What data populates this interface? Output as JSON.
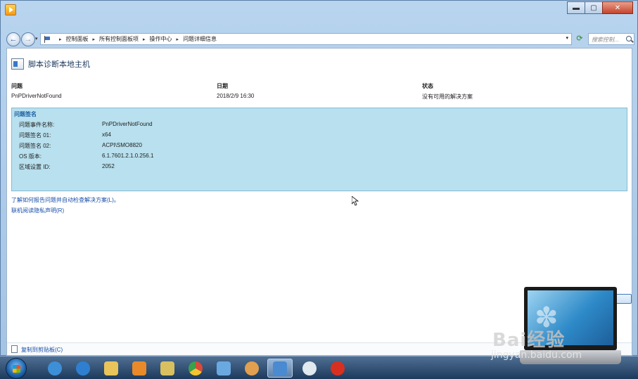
{
  "window": {
    "caption_buttons": {
      "minimize": "▬",
      "maximize": "▢",
      "close": "✕"
    }
  },
  "breadcrumb": [
    "控制面板",
    "所有控制面板项",
    "操作中心",
    "问题详细信息"
  ],
  "search": {
    "placeholder": "搜索控制..."
  },
  "page": {
    "title": "脚本诊断本地主机"
  },
  "problem": {
    "headers": {
      "problem": "问题",
      "date": "日期",
      "status": "状态"
    },
    "values": {
      "problem": "PnPDriverNotFound",
      "date": "2018/2/9 16:30",
      "status": "没有可用的解决方案"
    }
  },
  "signature": {
    "title": "问题签名",
    "rows": [
      {
        "label": "问题事件名称:",
        "value": "PnPDriverNotFound"
      },
      {
        "label": "问题签名 01:",
        "value": "x64"
      },
      {
        "label": "问题签名 02:",
        "value": "ACPI\\SMO8820"
      },
      {
        "label": "OS 版本:",
        "value": "6.1.7601.2.1.0.256.1"
      },
      {
        "label": "区域设置 ID:",
        "value": "2052"
      }
    ]
  },
  "links": {
    "learn": "了解如何报告问题并自动检查解决方案(L)。",
    "privacy": "联机阅读隐私声明(R)"
  },
  "footer": {
    "copy": "复制到剪贴板(C)"
  },
  "watermark": {
    "brand": "Bai",
    "brand2": "经验",
    "url": "jingyan.baidu.com"
  },
  "taskbar": {
    "items": [
      {
        "name": "start-button"
      },
      {
        "name": "browser-icon",
        "color": "#3d8fd8"
      },
      {
        "name": "ie-icon",
        "color": "#2f7fd0"
      },
      {
        "name": "explorer-icon",
        "color": "#e8c45a"
      },
      {
        "name": "media-player-icon",
        "color": "#e88a2a"
      },
      {
        "name": "folder-icon",
        "color": "#d8c060"
      },
      {
        "name": "chrome-icon",
        "color": "#d84a3a"
      },
      {
        "name": "document-icon",
        "color": "#6aa8e0"
      },
      {
        "name": "paint-icon",
        "color": "#e0a050"
      },
      {
        "name": "control-panel-icon",
        "color": "#4a8ad0"
      },
      {
        "name": "flower-icon",
        "color": "#e0e8f0"
      },
      {
        "name": "chess-icon",
        "color": "#d83020"
      }
    ]
  },
  "colors": {
    "accent": "#1e5fa0",
    "signature_bg": "#b8e0ee",
    "link": "#1a4fa8"
  }
}
